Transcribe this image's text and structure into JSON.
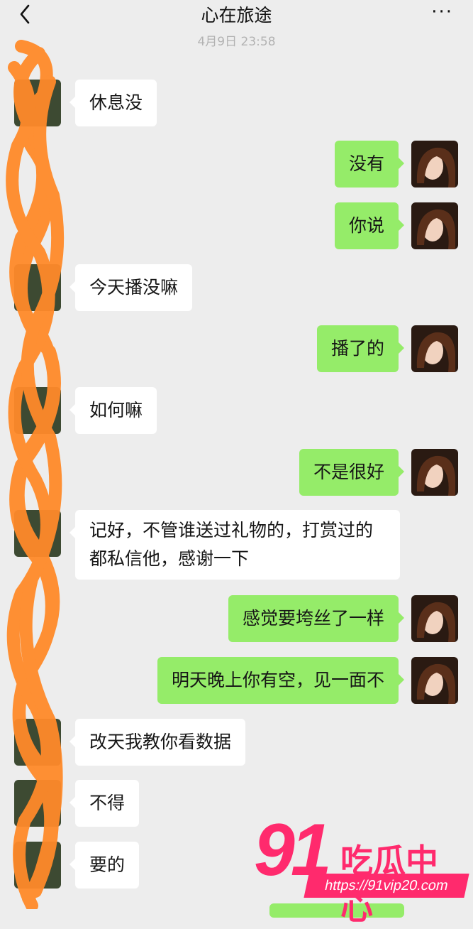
{
  "header": {
    "title": "心在旅途",
    "back_glyph": "‹",
    "more_glyph": "···"
  },
  "timestamp": "4月9日 23:58",
  "messages": [
    {
      "from": "other",
      "text": "休息没"
    },
    {
      "from": "me",
      "text": "没有"
    },
    {
      "from": "me",
      "text": "你说"
    },
    {
      "from": "other",
      "text": "今天播没嘛"
    },
    {
      "from": "me",
      "text": "播了的"
    },
    {
      "from": "other",
      "text": "如何嘛"
    },
    {
      "from": "me",
      "text": "不是很好"
    },
    {
      "from": "other",
      "text": "记好，不管谁送过礼物的，打赏过的都私信他，感谢一下"
    },
    {
      "from": "me",
      "text": "感觉要垮丝了一样"
    },
    {
      "from": "me",
      "text": "明天晚上你有空，见一面不"
    },
    {
      "from": "other",
      "text": "改天我教你看数据"
    },
    {
      "from": "other",
      "text": "不得"
    },
    {
      "from": "other",
      "text": "要的"
    }
  ],
  "watermark": {
    "number": "91",
    "text": "吃瓜中心",
    "url": "https://91vip20.com"
  },
  "colors": {
    "me_bubble": "#95ec69",
    "other_bubble": "#ffffff",
    "background": "#ededed",
    "scribble": "#ff8a2a",
    "watermark": "#ff2a6d"
  }
}
